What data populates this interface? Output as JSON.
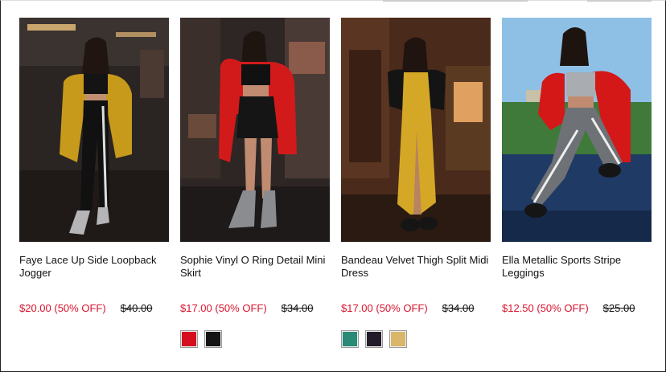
{
  "products": [
    {
      "name": "Faye Lace Up Side Loopback Jogger",
      "sale_price": "$20.00 (50% OFF)",
      "original_price": "$40.00",
      "image_desc": "model-in-mustard-coat",
      "swatches": []
    },
    {
      "name": "Sophie Vinyl O Ring Detail Mini Skirt",
      "sale_price": "$17.00 (50% OFF)",
      "original_price": "$34.00",
      "image_desc": "model-in-red-coat",
      "swatches": [
        {
          "name": "red",
          "color": "#d4101e"
        },
        {
          "name": "black",
          "color": "#141414"
        }
      ]
    },
    {
      "name": "Bandeau Velvet Thigh Split Midi Dress",
      "sale_price": "$17.00 (50% OFF)",
      "original_price": "$34.00",
      "image_desc": "model-in-gold-dress",
      "swatches": [
        {
          "name": "teal",
          "color": "#2a8a76"
        },
        {
          "name": "black",
          "color": "#221b2a"
        },
        {
          "name": "gold",
          "color": "#d9b66a"
        }
      ]
    },
    {
      "name": "Ella Metallic Sports Stripe Leggings",
      "sale_price": "$12.50 (50% OFF)",
      "original_price": "$25.00",
      "image_desc": "model-in-grey-leggings",
      "swatches": []
    }
  ],
  "colors": {
    "sale": "#d9122b",
    "text": "#111111"
  }
}
